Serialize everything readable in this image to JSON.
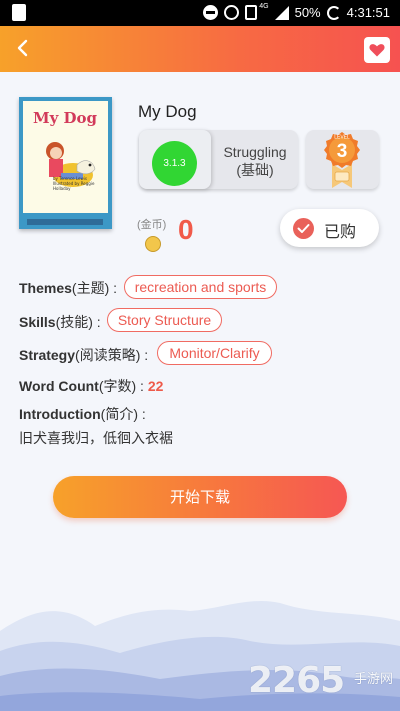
{
  "status_bar": {
    "battery": "50%",
    "time": "4:31:51",
    "network": "4G"
  },
  "header": {
    "back_icon": "chevron-left-icon",
    "favorite_icon": "heart-icon"
  },
  "book": {
    "title": "My Dog",
    "cover_title": "My Dog",
    "cover_credits": "by Terence Lewis Illustrated by Reggie Holladay",
    "level_code": "3.1.3",
    "level_name": "Struggling",
    "level_name_cn": "(基础)",
    "badge_label": "LEVEL",
    "badge_number": "3"
  },
  "coins": {
    "label": "(金币)",
    "value": "0"
  },
  "bought_button": {
    "label": "已购"
  },
  "info": {
    "themes_label": "Themes",
    "themes_cn": "(主题) :",
    "themes_value": "recreation and sports",
    "skills_label": "Skills",
    "skills_cn": "(技能) :",
    "skills_value": "Story Structure",
    "strategy_label": "Strategy",
    "strategy_cn": "(阅读策略) :",
    "strategy_value": "Monitor/Clarify",
    "wordcount_label": "Word Count",
    "wordcount_cn": "(字数) :",
    "wordcount_value": "22",
    "intro_label": "Introduction",
    "intro_cn": "(简介) :",
    "intro_text": "旧犬喜我归，低徊入衣裾"
  },
  "start_button": {
    "label": "开始下载"
  },
  "watermark": {
    "brand": "2265",
    "brand_cn": "手游网"
  }
}
